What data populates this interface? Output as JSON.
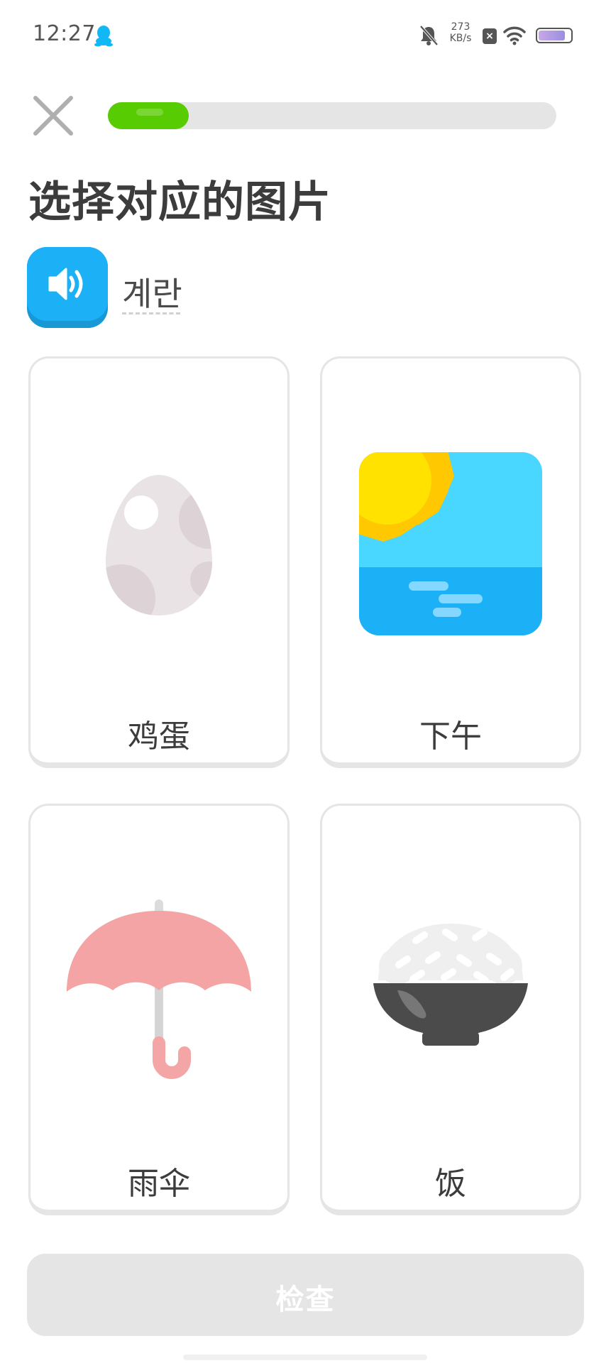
{
  "status_bar": {
    "time": "12:27",
    "net_speed_value": "273",
    "net_speed_unit": "KB/s",
    "battery_level": 0.85
  },
  "lesson": {
    "progress": 0.18,
    "prompt": "选择对应的图片",
    "target_word": "계란"
  },
  "options": [
    {
      "label": "鸡蛋",
      "icon": "egg-icon"
    },
    {
      "label": "下午",
      "icon": "afternoon-sun-icon"
    },
    {
      "label": "雨伞",
      "icon": "umbrella-icon"
    },
    {
      "label": "饭",
      "icon": "rice-bowl-icon"
    }
  ],
  "check_button": {
    "label": "检查"
  },
  "colors": {
    "accent_green": "#58cc02",
    "speaker_blue": "#1cb0f6",
    "card_border": "#e5e5e5",
    "disabled_button": "#e5e5e5",
    "text": "#3c3c3c"
  }
}
